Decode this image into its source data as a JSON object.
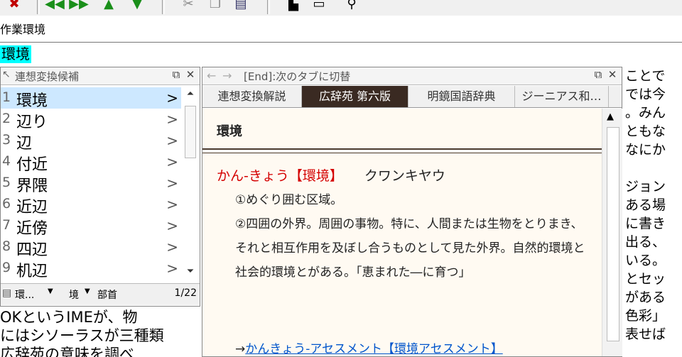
{
  "toolbar": {
    "icons": [
      "delete-icon",
      "prev-icon",
      "next-icon",
      "up-icon",
      "down-icon",
      "cut-icon",
      "copy-icon",
      "paste-icon",
      "new-window-icon",
      "window-icon",
      "search-icon"
    ]
  },
  "address": {
    "text": "作業環境"
  },
  "query": {
    "word": "環境"
  },
  "candidates": {
    "title": "連想変換候補",
    "items": [
      {
        "num": "1",
        "text": "環境"
      },
      {
        "num": "2",
        "text": "辺り"
      },
      {
        "num": "3",
        "text": "辺"
      },
      {
        "num": "4",
        "text": "付近"
      },
      {
        "num": "5",
        "text": "界隈"
      },
      {
        "num": "6",
        "text": "近辺"
      },
      {
        "num": "7",
        "text": "近傍"
      },
      {
        "num": "8",
        "text": "四辺"
      },
      {
        "num": "9",
        "text": "机辺"
      }
    ],
    "footer_left": "環...",
    "footer_mid": "境",
    "footer_mode": "部首",
    "page": "1/22"
  },
  "body_left": {
    "line1": "OKというIMEが、物",
    "line2": "にはシソーラスが三種類",
    "line3": "広辞苑の意味を調べ"
  },
  "dictionary": {
    "title": "[End]:次のタブに切替",
    "tabs": [
      "連想変換解説",
      "広辞苑 第六版",
      "明鏡国語辞典",
      "ジーニアス和…"
    ],
    "heading": "環境",
    "kana": "かん-きょう",
    "kanji": "【環境】",
    "reading": "クワンキヤウ",
    "def1": "①めぐり囲む区域。",
    "def2": "②四囲の外界。周囲の事物。特に、人間または生物をとりまき、それと相互作用を及ぼし合うものとして見た外界。自然的環境と社会的環境とがある。「恵まれた―に育つ」",
    "link_prefix": "→",
    "link": "かんきょう-アセスメント【環境アセスメント】"
  },
  "body_right": {
    "lines": [
      "ことで",
      "では今",
      "。みん",
      "ともな",
      "なにか",
      "",
      "ジョン",
      "ある場",
      "に書き",
      "出る、",
      "いる。",
      "とセッ",
      "がある",
      "色彩」",
      "表せば"
    ]
  }
}
